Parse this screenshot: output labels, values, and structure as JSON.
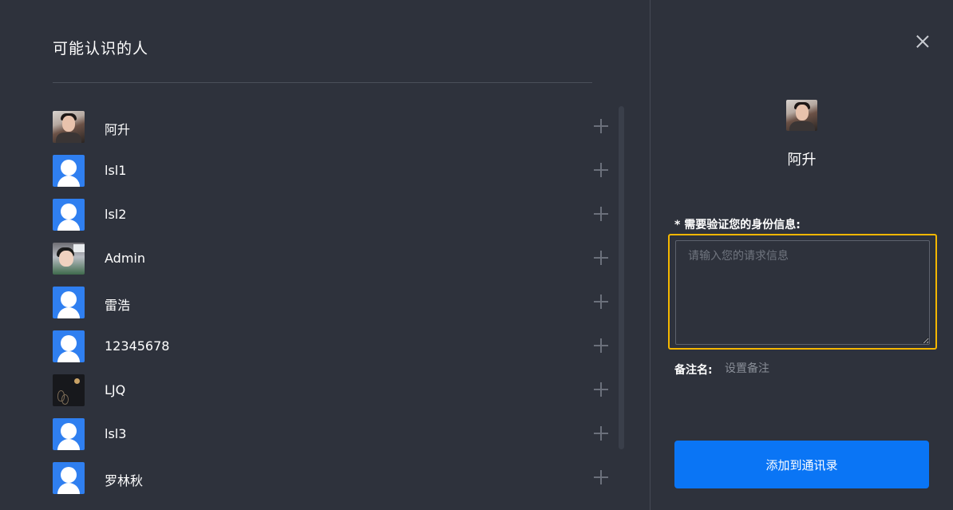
{
  "left_panel": {
    "title": "可能认识的人",
    "contacts": [
      {
        "name": "阿升",
        "avatar": "photo-man"
      },
      {
        "name": "lsl1",
        "avatar": "default-user-icon"
      },
      {
        "name": "lsl2",
        "avatar": "default-user-icon"
      },
      {
        "name": "Admin",
        "avatar": "photo-woman"
      },
      {
        "name": "雷浩",
        "avatar": "default-user-icon"
      },
      {
        "name": "12345678",
        "avatar": "default-user-icon"
      },
      {
        "name": "LJQ",
        "avatar": "photo-dark-art"
      },
      {
        "name": "lsl3",
        "avatar": "default-user-icon"
      },
      {
        "name": "罗林秋",
        "avatar": "default-user-icon"
      }
    ],
    "add_icon": "plus-icon"
  },
  "right_panel": {
    "close_icon": "close-icon",
    "profile_name": "阿升",
    "request_label": "* 需要验证您的身份信息:",
    "request_placeholder": "请输入您的请求信息",
    "request_value": "",
    "remark_label": "备注名:",
    "remark_placeholder": "设置备注",
    "add_button_label": "添加到通讯录"
  },
  "colors": {
    "background": "#2e323c",
    "accent": "#0a75f5",
    "highlight_border": "#f5b700",
    "default_avatar": "#2f7ff0"
  }
}
